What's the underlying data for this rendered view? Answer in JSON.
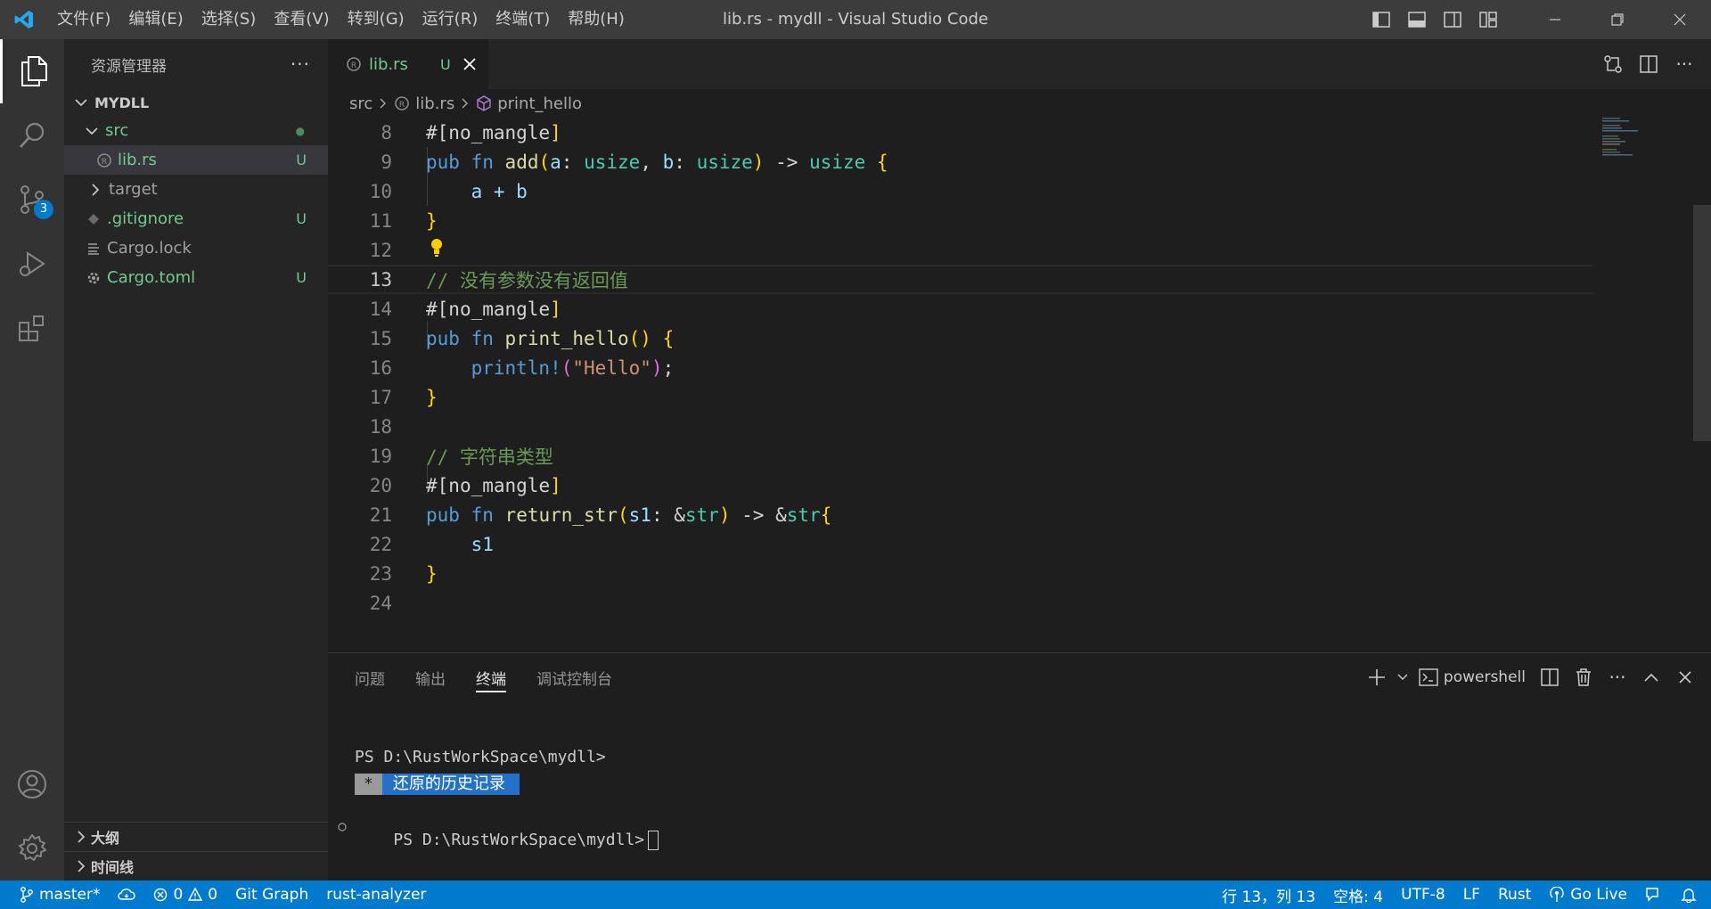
{
  "window": {
    "title": "lib.rs - mydll - Visual Studio Code",
    "menus": [
      "文件(F)",
      "编辑(E)",
      "选择(S)",
      "查看(V)",
      "转到(G)",
      "运行(R)",
      "终端(T)",
      "帮助(H)"
    ]
  },
  "activity": {
    "scm_badge": "3"
  },
  "sidebar": {
    "title": "资源管理器",
    "project": "MYDLL",
    "tree": [
      {
        "label": "src",
        "status": "●"
      },
      {
        "label": "lib.rs",
        "status": "U"
      },
      {
        "label": "target",
        "status": ""
      },
      {
        "label": ".gitignore",
        "status": "U"
      },
      {
        "label": "Cargo.lock",
        "status": ""
      },
      {
        "label": "Cargo.toml",
        "status": "U"
      }
    ],
    "outline": "大纲",
    "timeline": "时间线"
  },
  "editor": {
    "tab_label": "lib.rs",
    "tab_status": "U",
    "breadcrumb": [
      "src",
      "lib.rs",
      "print_hello"
    ],
    "line_numbers": [
      "8",
      "9",
      "10",
      "11",
      "12",
      "13",
      "14",
      "15",
      "16",
      "17",
      "18",
      "19",
      "20",
      "21",
      "22",
      "23",
      "24"
    ],
    "current_line": "13",
    "tokens": {
      "attr_open": "#[",
      "attr_name": "no_mangle",
      "attr_close": "]",
      "pub": "pub",
      "fn": "fn",
      "add": "add",
      "add_params_open": "(",
      "a": "a",
      "b": "b",
      "colon": ": ",
      "usize": "usize",
      "comma": ", ",
      "params_close": ")",
      "arrow": " -> ",
      "brace_open": "{",
      "brace_close": "}",
      "a_plus_b": "a + b",
      "comment1": "// 没有参数没有返回值",
      "print_hello": "print_hello",
      "empty_parens": "()",
      "println": "println!",
      "paren_open": "(",
      "hello_str": "\"Hello\"",
      "paren_close": ")",
      "semicolon": ";",
      "comment2": "// 字符串类型",
      "return_str": "return_str",
      "s1": "s1",
      "amp": "&",
      "str": "str"
    }
  },
  "panel": {
    "tabs": [
      "问题",
      "输出",
      "终端",
      "调试控制台"
    ],
    "active_tab": "终端",
    "shell": "powershell",
    "terminal": {
      "prompt1": "PS D:\\RustWorkSpace\\mydll>",
      "history_star": "*",
      "history_text": "还原的历史记录",
      "prompt2": "PS D:\\RustWorkSpace\\mydll>"
    }
  },
  "statusbar": {
    "branch": "master*",
    "errors": "0",
    "warnings": "0",
    "git_graph": "Git Graph",
    "rust_analyzer": "rust-analyzer",
    "position": "行 13，列 13",
    "spaces": "空格: 4",
    "encoding": "UTF-8",
    "eol": "LF",
    "language": "Rust",
    "go_live": "Go Live"
  },
  "colors": {
    "accent": "#007acc",
    "untracked": "#73c991",
    "titlebar": "#3c3c3c"
  }
}
